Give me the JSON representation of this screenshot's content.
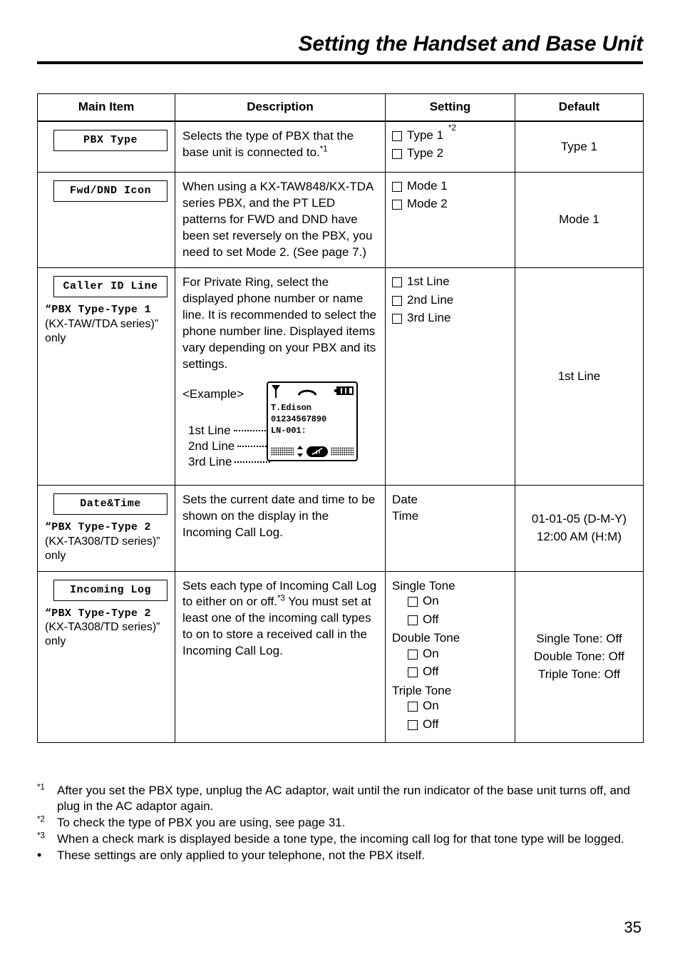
{
  "header": {
    "title": "Setting the Handset and Base Unit"
  },
  "table": {
    "columns": [
      "Main Item",
      "Description",
      "Setting",
      "Default"
    ],
    "rows": [
      {
        "item_label": "PBX Type",
        "item_note_mono": "",
        "item_note_plain": "",
        "description": "Selects the type of PBX that the base unit is connected to.",
        "description_fn": "*1",
        "settings": [
          {
            "type": "checkbox",
            "label": "Type 1",
            "fn": "*2"
          },
          {
            "type": "checkbox",
            "label": "Type 2",
            "fn": ""
          }
        ],
        "default": [
          "Type 1"
        ]
      },
      {
        "item_label": "Fwd/DND Icon",
        "item_note_mono": "",
        "item_note_plain": "",
        "description": "When using a KX-TAW848/KX-TDA series PBX, and the PT LED patterns for FWD and DND have been set reversely on the PBX, you need to set Mode 2. (See page 7.)",
        "description_fn": "",
        "settings": [
          {
            "type": "checkbox",
            "label": "Mode 1",
            "fn": ""
          },
          {
            "type": "checkbox",
            "label": "Mode 2",
            "fn": ""
          }
        ],
        "default": [
          "Mode 1"
        ]
      },
      {
        "item_label": "Caller ID Line",
        "item_note_mono": "“PBX Type-Type 1",
        "item_note_plain": "(KX-TAW/TDA series)” only",
        "description": "For Private Ring, select the displayed phone number or name line. It is recommended to select the phone number line. Displayed items vary depending on your PBX and its settings.",
        "description_fn": "",
        "settings": [
          {
            "type": "checkbox",
            "label": "1st Line",
            "fn": ""
          },
          {
            "type": "checkbox",
            "label": "2nd Line",
            "fn": ""
          },
          {
            "type": "checkbox",
            "label": "3rd Line",
            "fn": ""
          }
        ],
        "default": [
          "1st Line"
        ]
      },
      {
        "item_label": "Date&Time",
        "item_note_mono": "“PBX Type-Type 2",
        "item_note_plain": "(KX-TA308/TD series)” only",
        "description": "Sets the current date and time to be shown on the display in the Incoming Call Log.",
        "description_fn": "",
        "settings": [
          {
            "type": "text",
            "label": "Date",
            "fn": ""
          },
          {
            "type": "text",
            "label": "Time",
            "fn": ""
          }
        ],
        "default": [
          "01-01-05 (D-M-Y)",
          "12:00 AM (H:M)"
        ]
      },
      {
        "item_label": "Incoming Log",
        "item_note_mono": "“PBX Type-Type 2",
        "item_note_plain": "(KX-TA308/TD series)” only",
        "description": "Sets each type of Incoming Call Log to either on or off.",
        "description_fn": "*3",
        "description_tail": "You must set at least one of the incoming call types to on to store a received call in the Incoming Call Log.",
        "settings": [
          {
            "type": "text",
            "label": "Single Tone",
            "fn": ""
          },
          {
            "type": "checkbox",
            "label": "On",
            "fn": "",
            "indent": true
          },
          {
            "type": "checkbox",
            "label": "Off",
            "fn": "",
            "indent": true
          },
          {
            "type": "text",
            "label": "Double Tone",
            "fn": ""
          },
          {
            "type": "checkbox",
            "label": "On",
            "fn": "",
            "indent": true
          },
          {
            "type": "checkbox",
            "label": "Off",
            "fn": "",
            "indent": true
          },
          {
            "type": "text",
            "label": "Triple Tone",
            "fn": ""
          },
          {
            "type": "checkbox",
            "label": "On",
            "fn": "",
            "indent": true
          },
          {
            "type": "checkbox",
            "label": "Off",
            "fn": "",
            "indent": true
          }
        ],
        "default": [
          "Single Tone: Off",
          "Double Tone: Off",
          "Triple Tone: Off"
        ]
      }
    ]
  },
  "example": {
    "caption": "<Example>",
    "line_labels": [
      "1st Line",
      "2nd Line",
      "3rd Line"
    ],
    "lcd": {
      "status_icons": [
        "antenna-icon",
        "handset-icon",
        "battery-icon"
      ],
      "text_lines": [
        "T.Edison",
        "01234567890",
        "LN-001:"
      ],
      "soft_icons": [
        "left-dot-block",
        "up-down-arrow-icon",
        "mute-icon",
        "right-dot-block"
      ]
    }
  },
  "footnotes": [
    {
      "mark": "*1",
      "text": "After you set the PBX type, unplug the AC adaptor, wait until the run indicator of the base unit turns off, and plug in the AC adaptor again."
    },
    {
      "mark": "*2",
      "text": "To check the type of PBX you are using, see page 31."
    },
    {
      "mark": "*3",
      "text": "When a check mark is displayed beside a tone type, the incoming call log for that tone type will be logged."
    }
  ],
  "bullet": {
    "marker": "•",
    "text": "These settings are only applied to your telephone, not the PBX itself."
  },
  "page_number": "35"
}
